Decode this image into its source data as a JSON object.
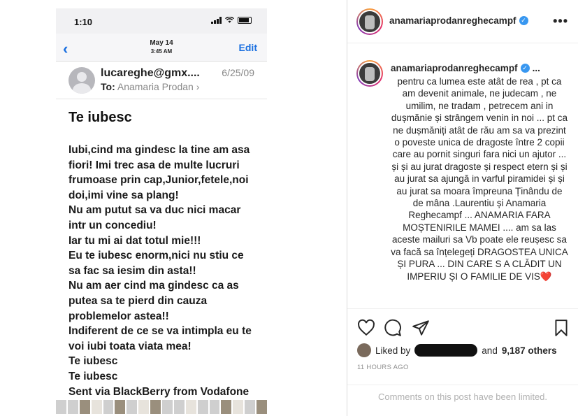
{
  "email": {
    "status_time": "1:10",
    "nav_date": "May 14",
    "nav_time": "3:45 AM",
    "edit_label": "Edit",
    "from": "lucareghe@gmx....",
    "date": "6/25/09",
    "to_label": "To:",
    "to_name": "Anamaria Prodan",
    "subject": "Te iubesc",
    "body_lines": [
      "Iubi,cind ma gindesc la tine am asa",
      "fiori! Imi trec asa de multe lucruri",
      "frumoase prin cap,Junior,fetele,noi",
      "doi,imi vine sa plang!",
      "Nu am putut sa va duc nici macar",
      "intr un concediu!",
      "Iar tu mi ai dat totul mie!!!",
      "Eu te iubesc enorm,nici nu stiu ce",
      "sa fac sa iesim din asta!!",
      "Nu am aer cind ma gindesc ca as",
      "putea sa te pierd din cauza",
      "problemelor astea!!",
      "Indiferent de ce se va intimpla eu te",
      "voi iubi toata viata mea!",
      "Te iubesc",
      "Te iubesc",
      "Sent via BlackBerry from Vodafone"
    ]
  },
  "post": {
    "username": "anamariaprodanreghecampf",
    "more_label": "•••",
    "caption_ellipsis": "...",
    "caption": "pentru ca lumea este atât de rea , pt ca am devenit animale, ne judecam , ne umilim, ne tradam , petrecem ani in dușmănie și strângem venin in noi ... pt ca ne dușmăniți atât de rău am sa va prezint o poveste unica de dragoste între 2 copii care au pornit singuri fara nici un ajutor ... și și au jurat dragoste și respect etern și și au jurat sa ajungă in varful piramidei și și au jurat sa moara împreuna Ținându de de mâna .Laurentiu și Anamaria Reghecampf ... ANAMARIA FARA MOȘTENIRILE MAMEI .... am sa las aceste mailuri sa Vb poate ele reușesc sa va facă sa înțelegeți DRAGOSTEA UNICA ȘI PURA ... DIN CARE S A CLĂDIT UN IMPERIU ȘI O FAMILIE DE VIS❤️",
    "liked_prefix": "Liked by",
    "liked_suffix": "and",
    "likes": "9,187 others",
    "time_ago": "11 HOURS AGO",
    "comments_limited": "Comments on this post have been limited."
  }
}
